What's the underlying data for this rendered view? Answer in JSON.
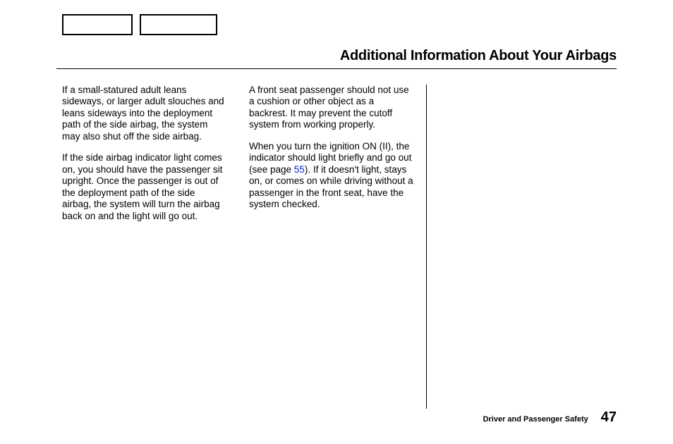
{
  "header": {
    "title": "Additional Information About Your Airbags"
  },
  "columns": {
    "left": {
      "paragraphs": [
        "If a small-statured adult leans sideways, or larger adult slouches and leans sideways into the deployment path of the side airbag, the system may also shut off the side airbag.",
        "If the side airbag indicator light comes on, you should have the passenger sit upright. Once the passenger is out of the deployment path of the side airbag, the system will turn the airbag back on and the light will go out."
      ]
    },
    "middle": {
      "paragraphs_a": "A front seat passenger should not use a cushion or other object as a backrest. It may prevent the cutoff system from working properly.",
      "paragraphs_b_pre": "When you turn the ignition ON (II), the indicator should light briefly and go out (see page ",
      "page_ref": "55",
      "paragraphs_b_post": "). If it doesn't light, stays on, or comes on while driving without a passenger in the front seat, have the system checked."
    }
  },
  "footer": {
    "section": "Driver and Passenger Safety",
    "page": "47"
  }
}
